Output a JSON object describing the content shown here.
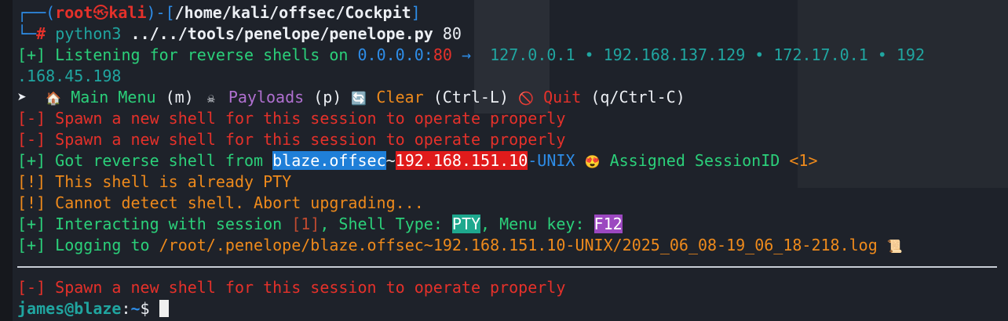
{
  "prompt": {
    "open": "┌──(",
    "user": "root",
    "sep_icon": "㉿",
    "host": "kali",
    "close": ")-[",
    "path": "/home/kali/offsec/Cockpit",
    "path_end": "]",
    "second": "└─",
    "hash": "#",
    "cmd": "python3",
    "script": "../../tools/penelope/penelope.py",
    "arg": "80"
  },
  "listen": {
    "tag": "[+]",
    "text": "Listening for reverse shells on",
    "addr": "0.0.0.0",
    "colon": ":",
    "port": "80",
    "arrow": "→",
    "ips": "127.0.0.1 • 192.168.137.129 • 172.17.0.1 • 192",
    "ips_wrap": ".168.45.198"
  },
  "menu": {
    "arrow": "➤",
    "main_icon": "🏠",
    "main": "Main Menu",
    "main_key": "(m)",
    "payload_icon": "☠",
    "payloads": "Payloads",
    "payload_key": "(p)",
    "clear_icon": "🔄",
    "clear": "Clear",
    "clear_key": "(Ctrl-L)",
    "quit_icon": "🚫",
    "quit": "Quit",
    "quit_key": "(q/Ctrl-C)"
  },
  "spawn1": "[-] Spawn a new shell for this session to operate properly",
  "spawn2": "[-] Spawn a new shell for this session to operate properly",
  "got": {
    "tag": "[+]",
    "text": "Got reverse shell from",
    "host": "blaze.offsec",
    "tilde": "~",
    "ip": "192.168.151.10",
    "os": "-UNIX",
    "emoji": "😍",
    "assigned": "Assigned SessionID",
    "sid": "<1>"
  },
  "pty_msg": "[!] This shell is already PTY",
  "detect_msg": "[!] Cannot detect shell. Abort upgrading...",
  "interact": {
    "tag": "[+]",
    "text": "Interacting with session",
    "num": "[1]",
    "shell_type": ", Shell Type:",
    "pty": "PTY",
    "menu_key": ", Menu key:",
    "key": "F12"
  },
  "log": {
    "tag": "[+]",
    "text": "Logging to",
    "path": "/root/.penelope/blaze.offsec~192.168.151.10-UNIX/2025_06_08-19_06_18-218.log",
    "icon": "📜"
  },
  "spawn3": "[-] Spawn a new shell for this session to operate properly",
  "shell": {
    "user_host": "james@blaze",
    "colon": ":",
    "cwd": "~",
    "dollar": "$"
  }
}
